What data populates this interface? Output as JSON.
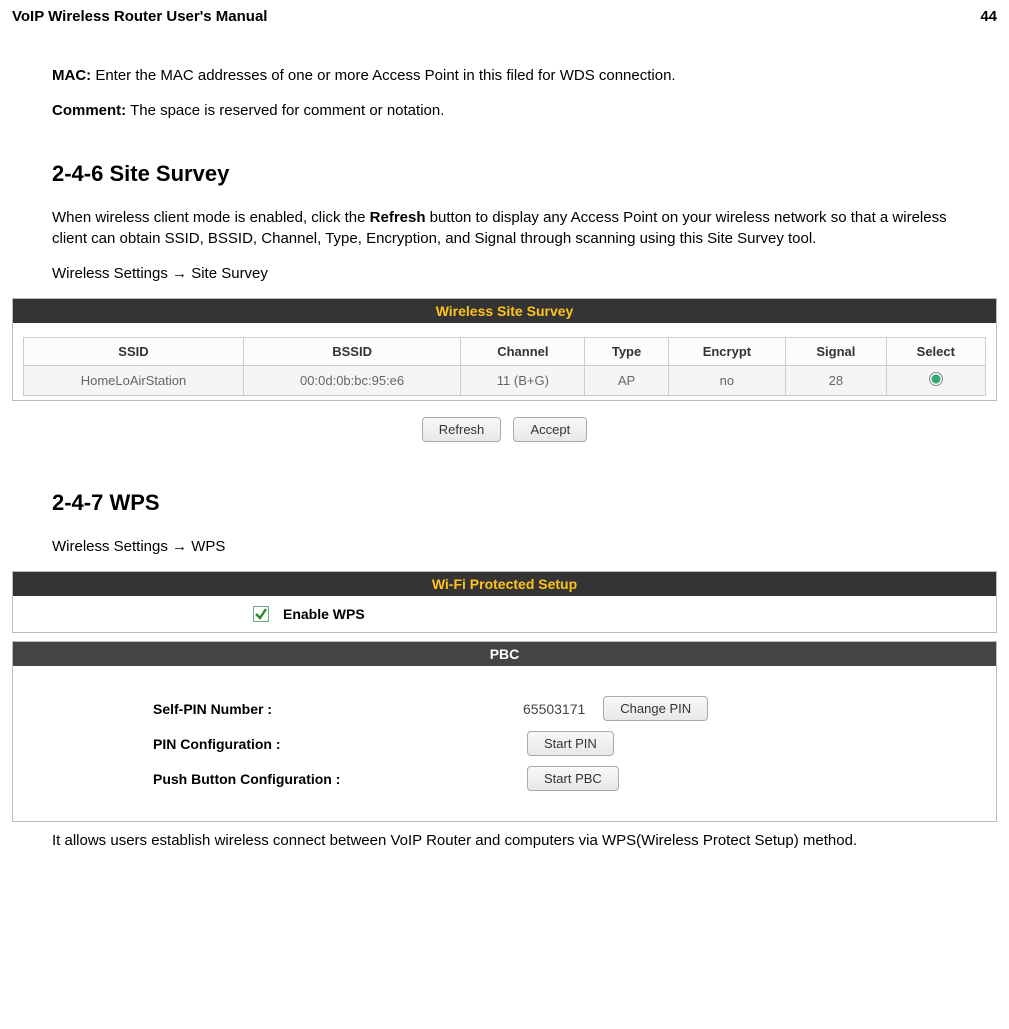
{
  "header": {
    "title": "VoIP Wireless Router User's Manual",
    "page": "44"
  },
  "intro": {
    "mac_label": "MAC:",
    "mac_text": " Enter the MAC addresses of one or more Access Point in this filed for WDS connection.",
    "comment_label": "Comment:",
    "comment_text": " The space is reserved for comment or notation."
  },
  "section246": {
    "heading": "2-4-6 Site Survey",
    "p1_a": "When wireless client mode is enabled, click the ",
    "p1_bold": "Refresh",
    "p1_b": " button to display any Access Point on your wireless network so that a wireless client can obtain SSID, BSSID, Channel, Type, Encryption, and Signal through scanning using this Site Survey tool.",
    "breadcrumb": "Wireless Settings  →  Site Survey",
    "panel_title": "Wireless Site Survey",
    "columns": [
      "SSID",
      "BSSID",
      "Channel",
      "Type",
      "Encrypt",
      "Signal",
      "Select"
    ],
    "row": {
      "ssid": "HomeLoAirStation",
      "bssid": "00:0d:0b:bc:95:e6",
      "channel": "11 (B+G)",
      "type": "AP",
      "encrypt": "no",
      "signal": "28"
    },
    "buttons": {
      "refresh": "Refresh",
      "accept": "Accept"
    }
  },
  "section247": {
    "heading": "2-4-7 WPS",
    "breadcrumb": "Wireless Settings  →  WPS",
    "wps_panel_title": "Wi-Fi Protected Setup",
    "enable_wps_label": "Enable WPS",
    "pbc_panel_title": "PBC",
    "rows": {
      "self_pin_label": "Self-PIN Number :",
      "self_pin_value": "65503171",
      "change_pin_btn": "Change PIN",
      "pin_config_label": "PIN Configuration :",
      "start_pin_btn": "Start PIN",
      "push_btn_label": "Push Button Configuration :",
      "start_pbc_btn": "Start PBC"
    },
    "footer": "It allows users establish wireless connect between VoIP Router and computers via WPS(Wireless Protect Setup) method."
  }
}
